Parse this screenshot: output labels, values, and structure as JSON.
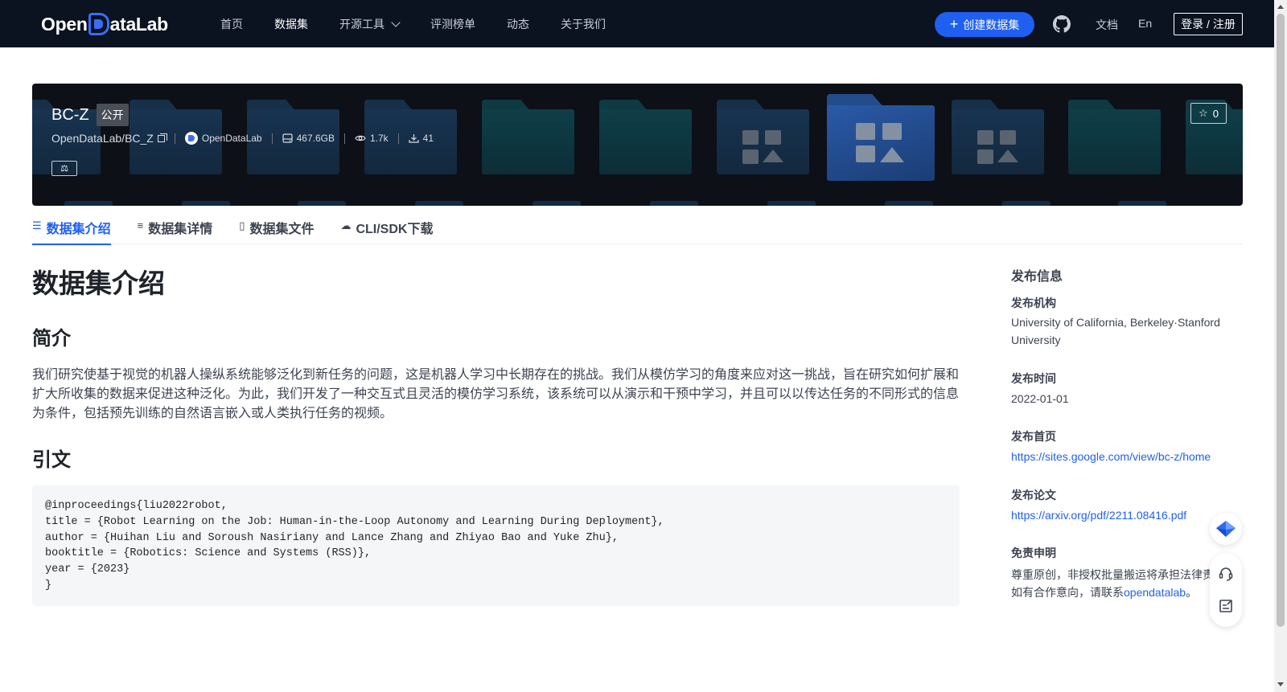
{
  "header": {
    "logo_text_pre": "Open",
    "logo_text_post": "ataLab",
    "nav": [
      {
        "label": "首页"
      },
      {
        "label": "数据集"
      },
      {
        "label": "开源工具"
      },
      {
        "label": "评测榜单"
      },
      {
        "label": "动态"
      },
      {
        "label": "关于我们"
      }
    ],
    "create_button": "创建数据集",
    "docs_link": "文档",
    "lang_link": "En",
    "login_button": "登录 / 注册"
  },
  "dataset": {
    "name": "BC-Z",
    "visibility": "公开",
    "path": "OpenDataLab/BC_Z",
    "org": "OpenDataLab",
    "size": "467.6GB",
    "views": "1.7k",
    "downloads": "41",
    "stars": "0"
  },
  "tabs": [
    {
      "label": "数据集介绍",
      "icon": "database-icon"
    },
    {
      "label": "数据集详情",
      "icon": "list-icon"
    },
    {
      "label": "数据集文件",
      "icon": "file-icon"
    },
    {
      "label": "CLI/SDK下载",
      "icon": "cloud-icon"
    }
  ],
  "content": {
    "heading": "数据集介绍",
    "intro_heading": "简介",
    "intro_text": "我们研究使基于视觉的机器人操纵系统能够泛化到新任务的问题，这是机器人学习中长期存在的挑战。我们从模仿学习的角度来应对这一挑战，旨在研究如何扩展和扩大所收集的数据来促进这种泛化。为此，我们开发了一种交互式且灵活的模仿学习系统，该系统可以从演示和干预中学习，并且可以以传达任务的不同形式的信息为条件，包括预先训练的自然语言嵌入或人类执行任务的视频。",
    "citation_heading": "引文",
    "citation": "@inproceedings{liu2022robot,\ntitle = {Robot Learning on the Job: Human-in-the-Loop Autonomy and Learning During Deployment},\nauthor = {Huihan Liu and Soroush Nasiriany and Lance Zhang and Zhiyao Bao and Yuke Zhu},\nbooktitle = {Robotics: Science and Systems (RSS)},\nyear = {2023}\n}"
  },
  "sidebar": {
    "title": "发布信息",
    "org_label": "发布机构",
    "org_value": "University of California, Berkeley·Stanford University",
    "date_label": "发布时间",
    "date_value": "2022-01-01",
    "home_label": "发布首页",
    "home_value": "https://sites.google.com/view/bc-z/home",
    "paper_label": "发布论文",
    "paper_value": "https://arxiv.org/pdf/2211.08416.pdf",
    "disclaimer_label": "免责申明",
    "disclaimer_line1": "尊重原创，非授权批量搬运将承担法律责",
    "disclaimer_line2_pre": "如有合作意向，请联系",
    "disclaimer_link": "opendatalab",
    "disclaimer_line2_post": "。"
  },
  "colors": {
    "accent": "#1f5ff2",
    "topbar": "#0b1220",
    "banner": "#0d1017"
  }
}
